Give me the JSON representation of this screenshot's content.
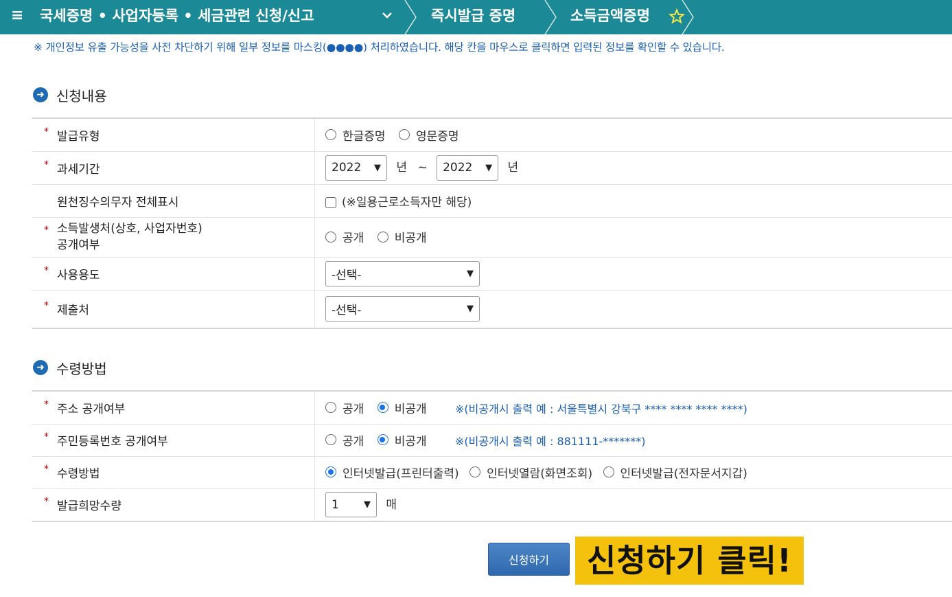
{
  "topbar": {
    "menu_icon": "≡",
    "title": "국세증명 • 사업자등록 • 세금관련 신청/신고",
    "dropdown_icon": "chevron-down",
    "crumb1": "즉시발급 증명",
    "crumb2": "소득금액증명",
    "favorite_icon": "star-outline",
    "background_color": "#1c8a96"
  },
  "notice": "※ 개인정보 유출 가능성을 사전 차단하기 위해 일부 정보를 마스킹(●●●●) 처리하였습니다. 해당 칸을 마우스로 클릭하면 입력된 정보를 확인할 수 있습니다.",
  "section1": {
    "title": "신청내용",
    "rows": {
      "issue_type": {
        "label": "발급유형",
        "opt1": "한글증명",
        "opt2": "영문증명"
      },
      "tax_period": {
        "label": "과세기간",
        "from": "2022",
        "year1": "년",
        "tilde": "~",
        "to": "2022",
        "year2": "년"
      },
      "withholding": {
        "label": "원천징수의무자 전체표시",
        "note": "(※일용근로소득자만 해당)"
      },
      "disclosure": {
        "label_line1": "소득발생처(상호, 사업자번호)",
        "label_line2": "공개여부",
        "opt1": "공개",
        "opt2": "비공개"
      },
      "purpose": {
        "label": "사용용도",
        "value": "-선택-"
      },
      "submit_to": {
        "label": "제출처",
        "value": "-선택-"
      }
    }
  },
  "section2": {
    "title": "수령방법",
    "rows": {
      "address": {
        "label": "주소 공개여부",
        "opt1": "공개",
        "opt2": "비공개",
        "hint": "※(비공개시 출력 예 : 서울특별시 강북구 **** **** **** ****)"
      },
      "rrn": {
        "label": "주민등록번호 공개여부",
        "opt1": "공개",
        "opt2": "비공개",
        "hint": "※(비공개시 출력 예 : 881111-*******)"
      },
      "method": {
        "label": "수령방법",
        "opt1": "인터넷발급(프린터출력)",
        "opt2": "인터넷열람(화면조회)",
        "opt3": "인터넷발급(전자문서지갑)"
      },
      "quantity": {
        "label": "발급희망수량",
        "value": "1",
        "unit": "매"
      }
    }
  },
  "submit_label": "신청하기",
  "callout": "신청하기 클릭!",
  "colors": {
    "accent": "#1a5fb4",
    "required": "#cc0000",
    "callout": "#f4c20d"
  }
}
